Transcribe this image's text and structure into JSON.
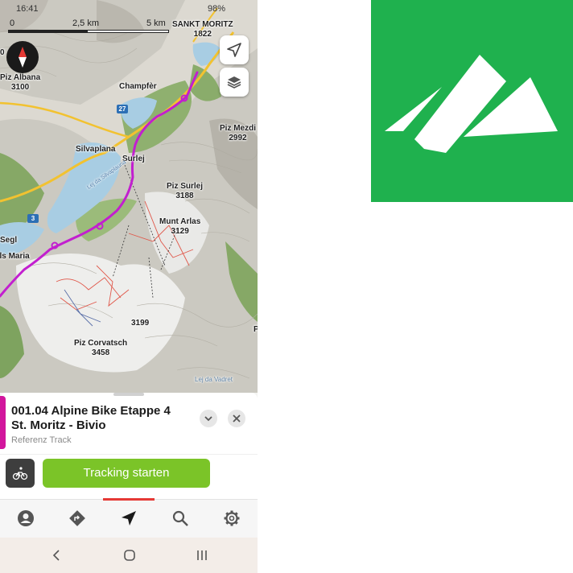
{
  "status_bar": {
    "time": "16:41",
    "battery": "98%"
  },
  "scale": {
    "zero": "0",
    "mid": "2,5 km",
    "end": "5 km"
  },
  "map_labels": {
    "sankt_moritz": {
      "name": "SANKT MORITZ",
      "ele": "1822"
    },
    "piz_albana": {
      "name": "Piz Albana",
      "ele": "3100"
    },
    "champfer": "Champfèr",
    "silvaplana": "Silvaplana",
    "surlej": "Surlej",
    "piz_mezdi": {
      "name": "Piz Mezdi",
      "ele": "2992"
    },
    "piz_surlej": {
      "name": "Piz Surlej",
      "ele": "3188"
    },
    "munt_arlas": {
      "name": "Munt Arlas",
      "ele": "3129"
    },
    "segl": "Segl",
    "sils_maria": "Sils Maria",
    "peak_3199": "3199",
    "piz_corvatsch": {
      "name": "Piz Corvatsch",
      "ele": "3458"
    },
    "vadret": "Lej da Vadret",
    "lake": "Lej da Silvaplauna",
    "road_27": "27",
    "road_3": "3",
    "edge_left": "0",
    "edge_right": "P"
  },
  "map_buttons": {
    "compass": "compass-icon",
    "locate": "locate-arrow-icon",
    "layers": "layers-icon"
  },
  "tour": {
    "title": "001.04 Alpine Bike Etappe 4 St. Moritz - Bivio",
    "subtitle": "Referenz Track",
    "accent_color": "#d2169d"
  },
  "actions": {
    "activity_icon": "mountain-bike-icon",
    "tracking_button": "Tracking starten",
    "tracking_color": "#7bc428"
  },
  "bottom_nav": {
    "items": [
      {
        "icon": "profile-icon",
        "active": false
      },
      {
        "icon": "route-planner-icon",
        "active": false
      },
      {
        "icon": "navigation-arrow-icon",
        "active": true
      },
      {
        "icon": "search-icon",
        "active": false
      },
      {
        "icon": "settings-gear-icon",
        "active": false
      }
    ],
    "active_color": "#e53935"
  },
  "system_nav": [
    "back-icon",
    "home-icon",
    "recent-apps-icon"
  ],
  "app_logo": {
    "icon": "mountain-logo-icon",
    "bg_color": "#1fb14e"
  }
}
